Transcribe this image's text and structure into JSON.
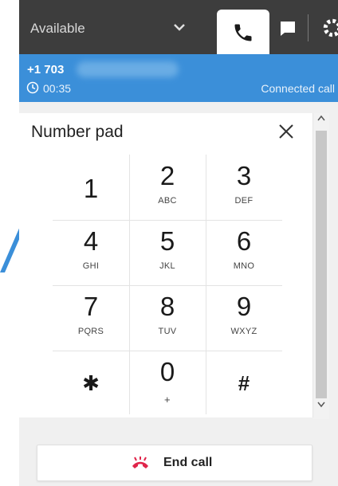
{
  "header": {
    "status": "Available",
    "icons": [
      "chevron-down-icon",
      "phone-icon",
      "chat-icon",
      "gear-icon"
    ]
  },
  "call": {
    "number": "+1 703",
    "timer": "00:35",
    "state": "Connected call"
  },
  "numpad": {
    "title": "Number pad",
    "keys": [
      {
        "digit": "1",
        "letters": ""
      },
      {
        "digit": "2",
        "letters": "ABC"
      },
      {
        "digit": "3",
        "letters": "DEF"
      },
      {
        "digit": "4",
        "letters": "GHI"
      },
      {
        "digit": "5",
        "letters": "JKL"
      },
      {
        "digit": "6",
        "letters": "MNO"
      },
      {
        "digit": "7",
        "letters": "PQRS"
      },
      {
        "digit": "8",
        "letters": "TUV"
      },
      {
        "digit": "9",
        "letters": "WXYZ"
      },
      {
        "digit": "✱",
        "letters": ""
      },
      {
        "digit": "0",
        "letters": "+"
      },
      {
        "digit": "#",
        "letters": ""
      }
    ]
  },
  "end_call": {
    "label": "End call"
  },
  "colors": {
    "topbar": "#3d3d3d",
    "callbar": "#3b8fd9",
    "end_call_icon": "#e0244a"
  }
}
